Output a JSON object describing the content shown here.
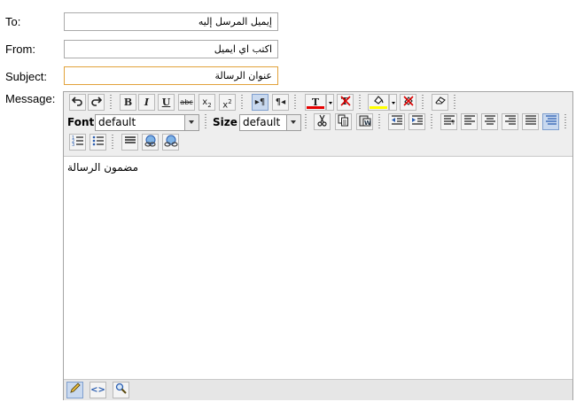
{
  "form": {
    "to": {
      "label": "To:",
      "value": "إيميل المرسل إليه"
    },
    "from": {
      "label": "From:",
      "value": "اكتب اي ايميل"
    },
    "subject": {
      "label": "Subject:",
      "value": "عنوان الرسالة"
    },
    "message": {
      "label": "Message:"
    }
  },
  "editor": {
    "font_label": "Font",
    "font_value": "default",
    "size_label": "Size",
    "size_value": "default",
    "content": "مضمون الرسالة",
    "font_color": "#e60000",
    "highlight_color": "#ffff00"
  }
}
